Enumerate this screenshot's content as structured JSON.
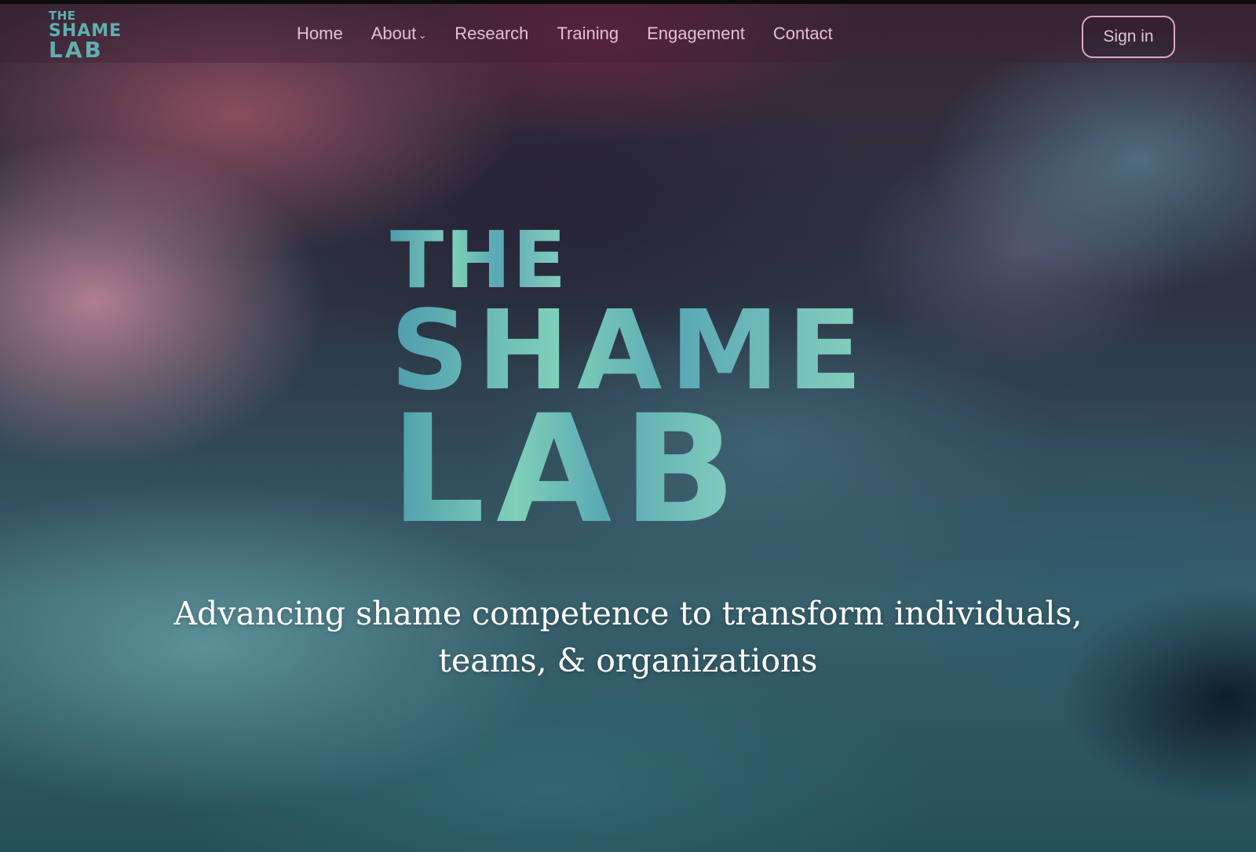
{
  "nav": {
    "logo": {
      "line1": "THE",
      "line2": "SHAME",
      "line3": "LAB"
    },
    "items": [
      {
        "label": "Home",
        "has_dropdown": false
      },
      {
        "label": "About",
        "has_dropdown": true
      },
      {
        "label": "Research",
        "has_dropdown": false
      },
      {
        "label": "Training",
        "has_dropdown": false
      },
      {
        "label": "Engagement",
        "has_dropdown": false
      },
      {
        "label": "Contact",
        "has_dropdown": false
      }
    ],
    "signin_label": "Sign in"
  },
  "hero": {
    "logo": {
      "line1": "THE",
      "line2": "SHAME",
      "line3": "LAB"
    },
    "tagline_line1": "Advancing shame competence to transform individuals,",
    "tagline_line2": "teams, & organizations"
  },
  "colors": {
    "nav_text": "#e1c2cf",
    "signin_border": "#dfa7bf",
    "logo_teal": "#5fb0b0",
    "logo_gradient_start": "#4f9cae",
    "logo_gradient_end": "#86d0bd",
    "tagline": "#ffffff"
  },
  "icons": {
    "about_dropdown": "chevron-down-icon"
  }
}
